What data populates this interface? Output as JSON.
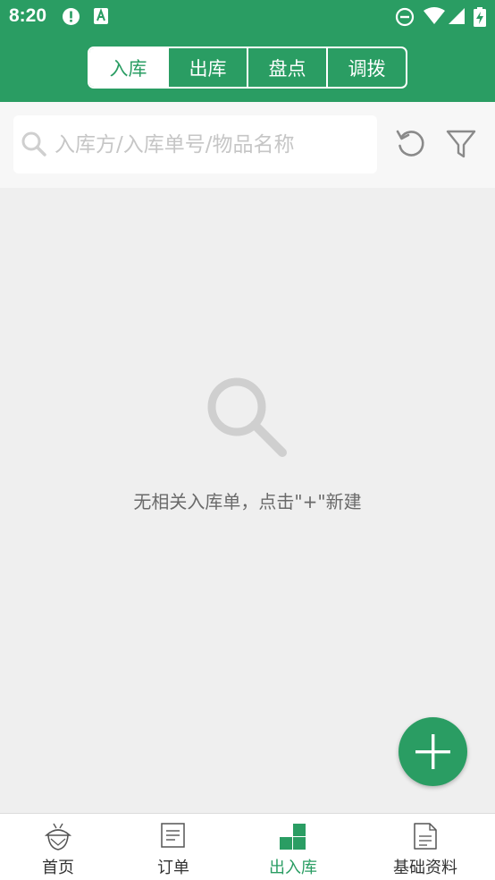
{
  "status_bar": {
    "time": "8:20"
  },
  "tabs": [
    {
      "label": "入库",
      "active": true
    },
    {
      "label": "出库",
      "active": false
    },
    {
      "label": "盘点",
      "active": false
    },
    {
      "label": "调拨",
      "active": false
    }
  ],
  "search": {
    "placeholder": "入库方/入库单号/物品名称",
    "value": ""
  },
  "empty_state": {
    "message": "无相关入库单，点击\"+\"新建"
  },
  "bottom_nav": [
    {
      "label": "首页",
      "icon": "acorn-icon",
      "active": false
    },
    {
      "label": "订单",
      "icon": "order-list-icon",
      "active": false
    },
    {
      "label": "出入库",
      "icon": "stock-blocks-icon",
      "active": true
    },
    {
      "label": "基础资料",
      "icon": "document-icon",
      "active": false
    }
  ],
  "colors": {
    "primary": "#2a9d63",
    "background": "#efefef",
    "placeholder": "#c6c6c6"
  }
}
